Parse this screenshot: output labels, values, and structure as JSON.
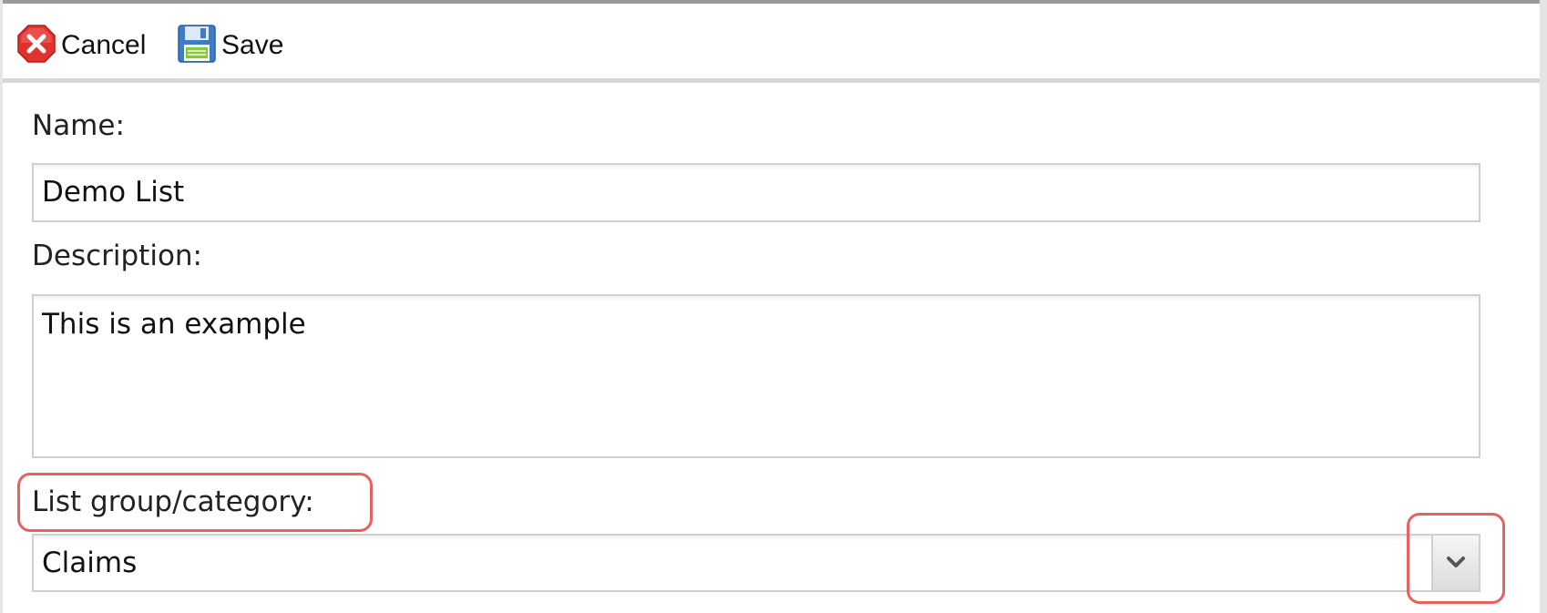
{
  "toolbar": {
    "cancel_label": "Cancel",
    "save_label": "Save",
    "icons": {
      "cancel": "cancel-x-icon",
      "save": "floppy-disk-icon"
    }
  },
  "form": {
    "name": {
      "label": "Name:",
      "value": "Demo List"
    },
    "description": {
      "label": "Description:",
      "value": "This is an example"
    },
    "list_group": {
      "label": "List group/category:",
      "value": "Claims"
    }
  },
  "colors": {
    "highlight": "#e8615f",
    "cancel_red": "#e0312d",
    "field_border": "#cfcfcf",
    "toolbar_divider": "#d6d6d6"
  }
}
